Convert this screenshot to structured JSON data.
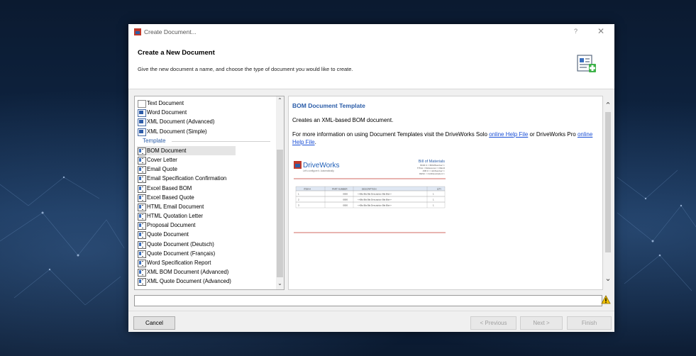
{
  "dialog": {
    "title": "Create Document...",
    "help_glyph": "?",
    "close_glyph": "✕",
    "icon_name": "document-app-icon"
  },
  "header": {
    "title": "Create a New Document",
    "description": "Give the new document a name, and choose the type of document you would like to create.",
    "icon_name": "new-document-add-icon"
  },
  "document_types": {
    "items": [
      {
        "label": "Text Document",
        "icon": "text-doc-icon",
        "kind": "txt"
      },
      {
        "label": "Word Document",
        "icon": "word-doc-icon",
        "kind": "doc"
      },
      {
        "label": "XML Document (Advanced)",
        "icon": "xml-doc-icon",
        "kind": "doc"
      },
      {
        "label": "XML Document (Simple)",
        "icon": "xml-doc-icon",
        "kind": "doc"
      }
    ],
    "group_label": "Template",
    "templates": [
      {
        "label": "BOM Document",
        "selected": true
      },
      {
        "label": "Cover Letter"
      },
      {
        "label": "Email Quote"
      },
      {
        "label": "Email Specification Confirmation"
      },
      {
        "label": "Excel Based BOM"
      },
      {
        "label": "Excel Based Quote"
      },
      {
        "label": "HTML Email Document"
      },
      {
        "label": "HTML Quotation Letter"
      },
      {
        "label": "Proposal Document"
      },
      {
        "label": "Quote Document"
      },
      {
        "label": "Quote Document (Deutsch)"
      },
      {
        "label": "Quote Document (Français)"
      },
      {
        "label": "Word Specification Report"
      },
      {
        "label": "XML BOM Document (Advanced)"
      },
      {
        "label": "XML Quote Document (Advanced)"
      }
    ]
  },
  "preview": {
    "title": "BOM Document Template",
    "description": "Creates an XML-based BOM document.",
    "help_prefix": "For more information on using Document Templates visit the DriveWorks Solo ",
    "help_link_1": "online Help File",
    "help_middle": " or DriveWorks Pro ",
    "help_link_2": "online Help File",
    "help_suffix": ".",
    "thumbnail": {
      "brand": "DriveWorks",
      "tagline": "Let's configure it. Automatically.",
      "heading": "Bill of Materials",
      "meta_lines": [
        "BOM # <<BOMNumber>>",
        "TITLE <<Reference>> FIELD",
        "JOB # <<JobNumber>>",
        "DESC <<JobDescription>>"
      ],
      "columns": [
        "ITEM #",
        "PART NUMBER",
        "DESCRIPTION",
        "QTY"
      ],
      "rows": [
        [
          "1",
          "0000",
          "<<Bla Bla Bla Description Bla Bla>>",
          "1"
        ],
        [
          "2",
          "0000",
          "<<Bla Bla Bla Description Bla Bla>>",
          "1"
        ],
        [
          "3",
          "0000",
          "<<Bla Bla Bla Description Bla Bla>>",
          "1"
        ]
      ]
    }
  },
  "status": {
    "value": "",
    "warning_icon": "warning-icon"
  },
  "footer": {
    "cancel": "Cancel",
    "previous": "< Previous",
    "next": "Next >",
    "finish": "Finish"
  },
  "colors": {
    "accent": "#2a5ca8",
    "link": "#1a4fd6",
    "brand_red": "#c0392b",
    "warning": "#f2c200"
  }
}
